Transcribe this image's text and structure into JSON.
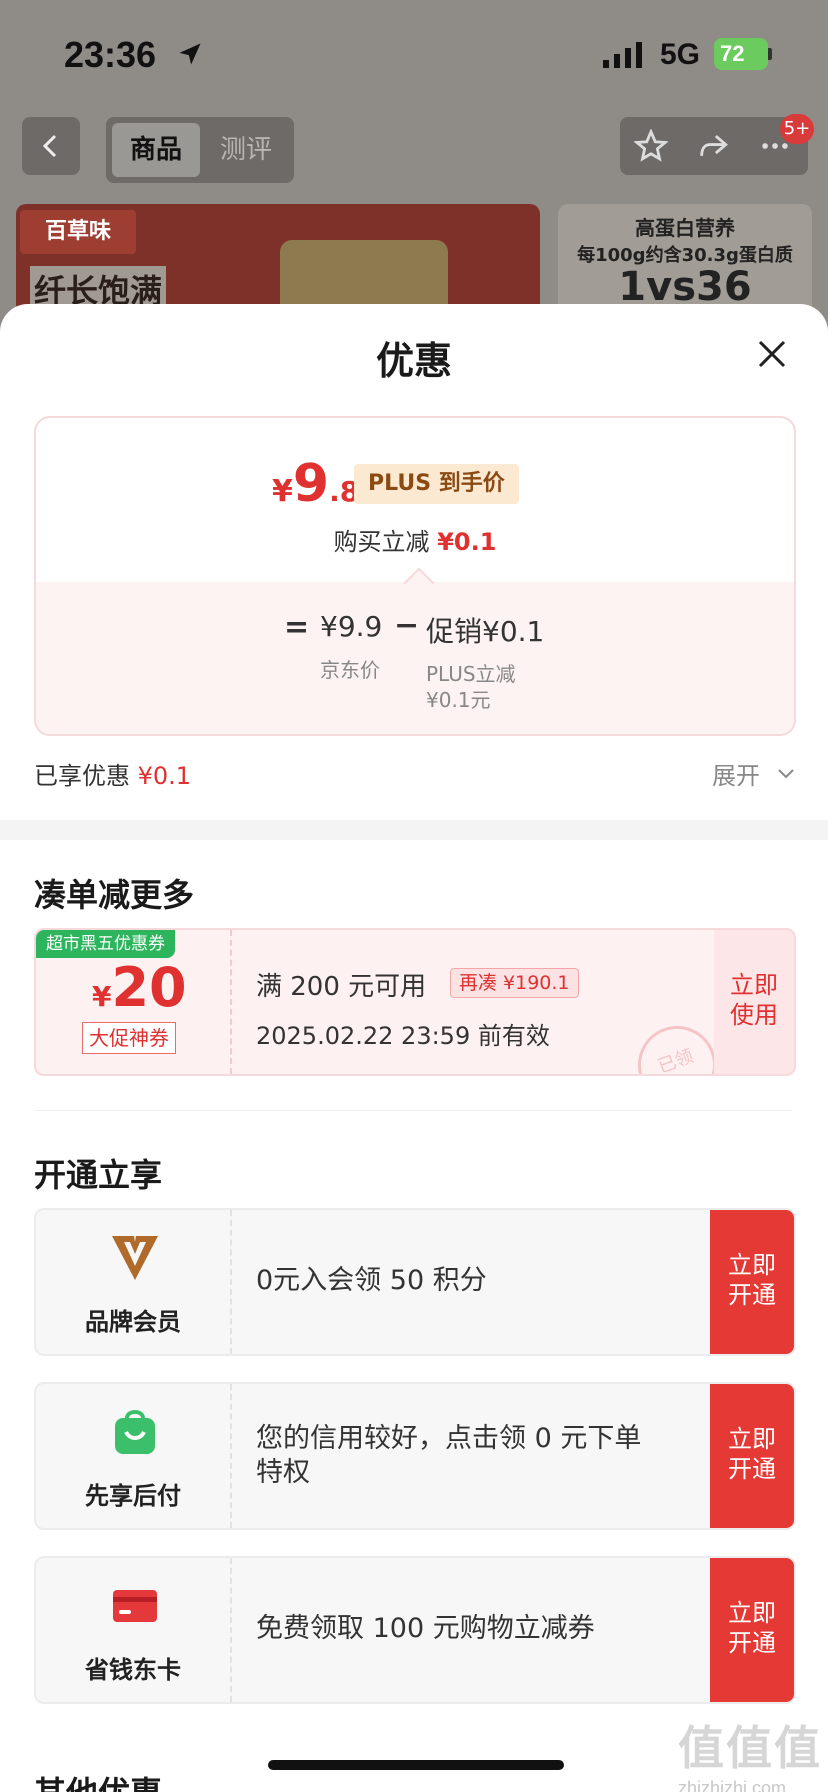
{
  "status_bar": {
    "time": "23:36",
    "network": "5G",
    "battery": "72"
  },
  "nav": {
    "tabs": [
      {
        "label": "商品",
        "active": true
      },
      {
        "label": "测评",
        "active": false
      }
    ],
    "badge": "5+"
  },
  "background_banner": {
    "brand": "百草味",
    "slogan": "纤长饱满",
    "right_line1": "高蛋白营养",
    "right_line2": "每100g约含30.3g蛋白质",
    "right_line3": "1vs36"
  },
  "sheet": {
    "title": "优惠",
    "price_card": {
      "currency": "¥",
      "price_int": "9",
      "price_dec": ".8",
      "plus_tag": "PLUS 到手价",
      "reduce_label": "购买立减",
      "reduce_value": "¥0.1",
      "equals": "=",
      "jd_price": "¥9.9",
      "jd_price_label": "京东价",
      "minus": "−",
      "promo": "促销¥0.1",
      "promo_sub1": "PLUS立减",
      "promo_sub2": "¥0.1元"
    },
    "enjoyed_label": "已享优惠",
    "enjoyed_value": "¥0.1",
    "expand_label": "展开",
    "section_more": "凑单减更多",
    "coupon": {
      "tag": "超市黑五优惠券",
      "currency": "¥",
      "amount": "20",
      "sub": "大促神券",
      "condition": "满 200 元可用",
      "more_tag": "再凑 ¥190.1",
      "validity": "2025.02.22 23:59 前有效",
      "stamp": "已领",
      "use_line1": "立即",
      "use_line2": "使用"
    },
    "section_open": "开通立享",
    "open_items": [
      {
        "label": "品牌会员",
        "desc": "0元入会领 50 积分",
        "btn1": "立即",
        "btn2": "开通"
      },
      {
        "label": "先享后付",
        "desc": "您的信用较好，点击领 0 元下单特权",
        "btn1": "立即",
        "btn2": "开通"
      },
      {
        "label": "省钱东卡",
        "desc": "免费领取 100 元购物立减券",
        "btn1": "立即",
        "btn2": "开通"
      }
    ],
    "section_other": "其他优惠"
  },
  "watermark": {
    "big": "值值值",
    "small": "zhizhizhi.com"
  },
  "colors": {
    "accent_red": "#e03131",
    "button_red": "#e53935",
    "coupon_green": "#2db55d"
  }
}
